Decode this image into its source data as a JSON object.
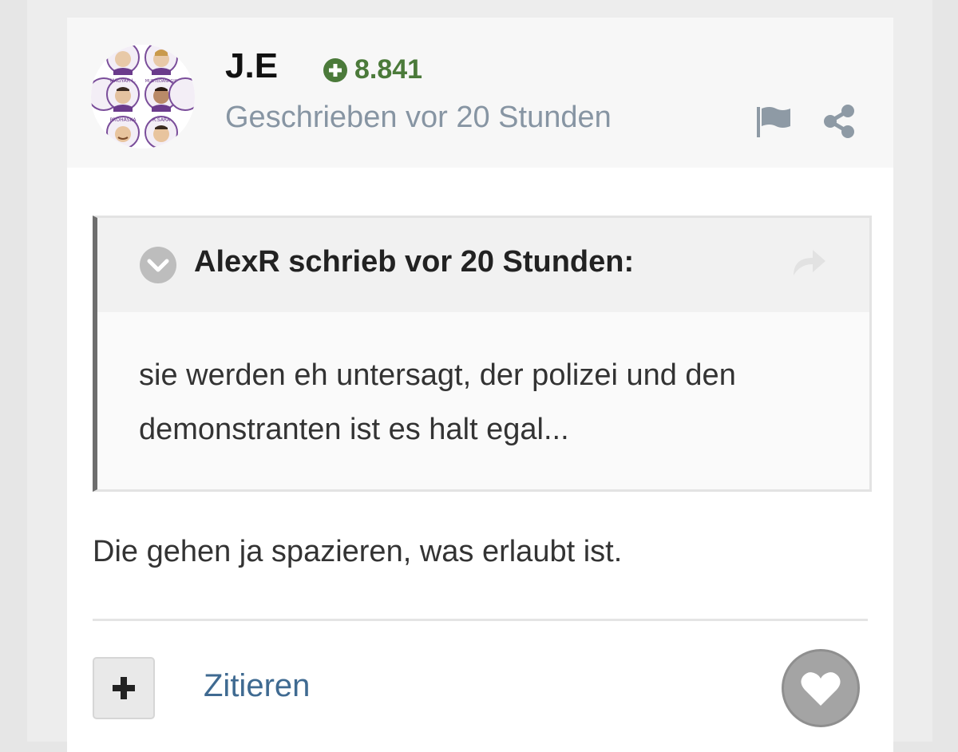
{
  "post": {
    "author": "J.E",
    "reputation": "8.841",
    "timestamp": "Geschrieben vor 20 Stunden",
    "text": "Die gehen ja spazieren, was erlaubt ist.",
    "avatar_labels": [
      "MAGYAR L.",
      "MUSTEDANAGIC",
      "PROHASKA",
      "R.SARA"
    ]
  },
  "quote": {
    "citation": "AlexR schrieb vor 20 Stunden:",
    "line1": "sie werden eh untersagt, der polizei und den",
    "line2": "demonstranten ist es halt egal..."
  },
  "actions": {
    "quote_label": "Zitieren",
    "multiquote_symbol": "+"
  },
  "icons": {
    "reputation": "plus-circle-icon",
    "report": "flag-icon",
    "share": "share-icon",
    "quote_toggle": "chevron-down-icon",
    "quote_jump": "reply-arrow-icon",
    "like": "heart-icon"
  },
  "colors": {
    "reputation": "#4b7a3a",
    "link": "#3f6a91",
    "timestamp": "#8795a3"
  }
}
